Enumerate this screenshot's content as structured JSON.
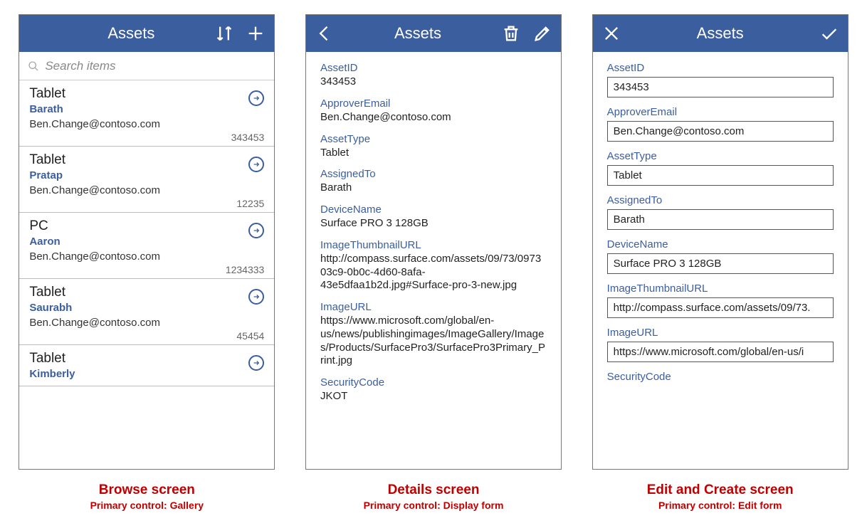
{
  "common": {
    "title": "Assets"
  },
  "browse": {
    "search_placeholder": "Search items",
    "items": [
      {
        "title": "Tablet",
        "assigned": "Barath",
        "email": "Ben.Change@contoso.com",
        "id": "343453"
      },
      {
        "title": "Tablet",
        "assigned": "Pratap",
        "email": "Ben.Change@contoso.com",
        "id": "12235"
      },
      {
        "title": "PC",
        "assigned": "Aaron",
        "email": "Ben.Change@contoso.com",
        "id": "1234333"
      },
      {
        "title": "Tablet",
        "assigned": "Saurabh",
        "email": "Ben.Change@contoso.com",
        "id": "45454"
      },
      {
        "title": "Tablet",
        "assigned": "Kimberly",
        "email": "",
        "id": ""
      }
    ],
    "caption_title": "Browse screen",
    "caption_sub": "Primary control: Gallery"
  },
  "details": {
    "fields": [
      {
        "label": "AssetID",
        "value": "343453"
      },
      {
        "label": "ApproverEmail",
        "value": "Ben.Change@contoso.com"
      },
      {
        "label": "AssetType",
        "value": "Tablet"
      },
      {
        "label": "AssignedTo",
        "value": "Barath"
      },
      {
        "label": "DeviceName",
        "value": "Surface PRO 3 128GB"
      },
      {
        "label": "ImageThumbnailURL",
        "value": "http://compass.surface.com/assets/09/73/097303c9-0b0c-4d60-8afa-43e5dfaa1b2d.jpg#Surface-pro-3-new.jpg"
      },
      {
        "label": "ImageURL",
        "value": "https://www.microsoft.com/global/en-us/news/publishingimages/ImageGallery/Images/Products/SurfacePro3/SurfacePro3Primary_Print.jpg"
      },
      {
        "label": "SecurityCode",
        "value": "JKOT"
      }
    ],
    "caption_title": "Details screen",
    "caption_sub": "Primary control: Display form"
  },
  "edit": {
    "fields": [
      {
        "label": "AssetID",
        "value": "343453"
      },
      {
        "label": "ApproverEmail",
        "value": "Ben.Change@contoso.com"
      },
      {
        "label": "AssetType",
        "value": "Tablet"
      },
      {
        "label": "AssignedTo",
        "value": "Barath"
      },
      {
        "label": "DeviceName",
        "value": "Surface PRO 3 128GB"
      },
      {
        "label": "ImageThumbnailURL",
        "value": "http://compass.surface.com/assets/09/73."
      },
      {
        "label": "ImageURL",
        "value": "https://www.microsoft.com/global/en-us/i"
      },
      {
        "label": "SecurityCode",
        "value": ""
      }
    ],
    "caption_title": "Edit and Create screen",
    "caption_sub": "Primary control: Edit form"
  }
}
